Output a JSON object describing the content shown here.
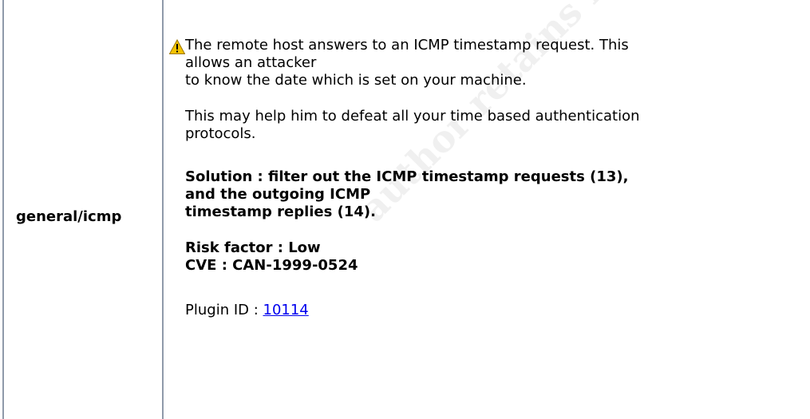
{
  "report": {
    "port": "general/icmp",
    "icon": "warning-icon",
    "description_lines": [
      "The remote host answers to an ICMP timestamp request. This",
      "allows an attacker",
      "to know the date which is set on your machine."
    ],
    "impact_lines": [
      "This may help him to defeat all your time based authentication",
      "protocols."
    ],
    "solution_lines": [
      "Solution : filter out the ICMP timestamp requests (13),",
      "and the outgoing ICMP",
      "timestamp replies (14)."
    ],
    "risk_factor": "Risk factor : Low",
    "cve": "CVE : CAN-1999-0524",
    "plugin_label": "Plugin ID : ",
    "plugin_id": "10114"
  },
  "watermark": "author retains full rights",
  "colors": {
    "border": "#8f9aaa",
    "link": "#0000ee",
    "warning": "#f2c200"
  }
}
